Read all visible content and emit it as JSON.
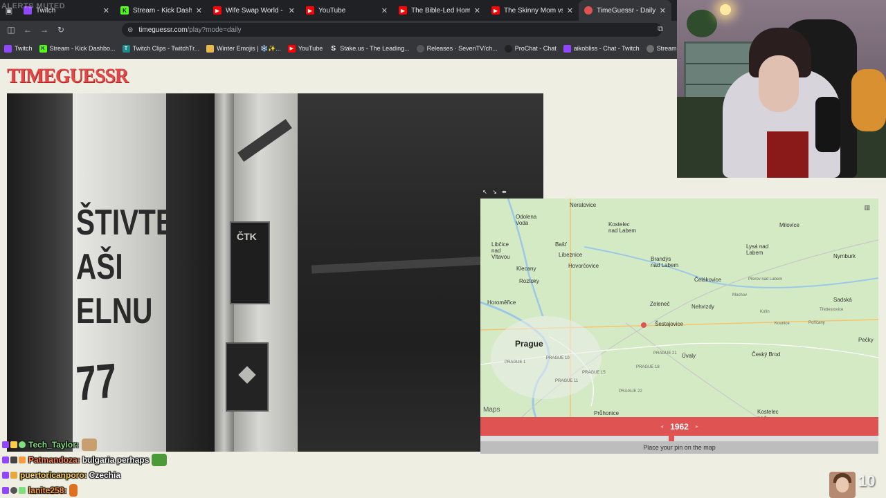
{
  "overlay": {
    "alerts_muted": "ALERTS MUTED"
  },
  "tabs": [
    {
      "label": "Twitch",
      "icon": "twitch-icon",
      "color": "#9146ff"
    },
    {
      "label": "Stream - Kick Dashboar",
      "icon": "kick-icon",
      "color": "#53fc18"
    },
    {
      "label": "Wife Swap World - YouTub",
      "icon": "youtube-icon",
      "color": "#ff0000"
    },
    {
      "label": "YouTube",
      "icon": "youtube-icon",
      "color": "#ff0000"
    },
    {
      "label": "The Bible-Led Home vs. Th",
      "icon": "youtube-icon",
      "color": "#ff0000"
    },
    {
      "label": "The Skinny Mom vs The He",
      "icon": "youtube-icon",
      "color": "#ff0000"
    },
    {
      "label": "TimeGuessr - Daily",
      "icon": "timeguessr-icon",
      "color": "#e05353",
      "active": true
    }
  ],
  "address": {
    "host": "timeguessr.com",
    "path": "/play?mode=daily"
  },
  "bookmarks": [
    {
      "label": "Twitch",
      "color": "#9146ff"
    },
    {
      "label": "Stream - Kick Dashbo...",
      "color": "#53fc18",
      "glyph": "K"
    },
    {
      "label": "Twitch Clips - TwitchTr...",
      "color": "#1f8a8a",
      "glyph": "TT"
    },
    {
      "label": "Winter Emojis | ❄️✨...",
      "color": "#e8b84a",
      "glyph": "▬"
    },
    {
      "label": "YouTube",
      "color": "#ff0000",
      "glyph": "▶"
    },
    {
      "label": "Stake.us - The Leading...",
      "color": "#35363a",
      "glyph": "S"
    },
    {
      "label": "Releases · SevenTV/ch...",
      "color": "#555",
      "glyph": "◉"
    },
    {
      "label": "ProChat - Chat",
      "color": "#222",
      "glyph": "◐"
    },
    {
      "label": "aikobliss - Chat - Twitch",
      "color": "#9146ff",
      "glyph": "▣"
    },
    {
      "label": "StreamElements - Das...",
      "color": "#6e6e6e",
      "glyph": "✪"
    }
  ],
  "game": {
    "logo": "TIMEGUESSR",
    "photo_wall_text": "ŠTIVTE\nAŠI\nELNU",
    "photo_wall_number": "77",
    "photo_sign_text": "ČTK",
    "year": "1962",
    "slider_fraction": 0.48,
    "pin_prompt": "Place your pin on the map",
    "map_attribution": " Maps"
  },
  "map_places": [
    {
      "name": "Neratovice",
      "cls": ""
    },
    {
      "name": "Odolena\nVoda",
      "cls": ""
    },
    {
      "name": "Kostelec\nnad Labem",
      "cls": ""
    },
    {
      "name": "Milovice",
      "cls": ""
    },
    {
      "name": "Libčice\nnad\nVltavou",
      "cls": ""
    },
    {
      "name": "Bašť",
      "cls": ""
    },
    {
      "name": "Lysá nad\nLabem",
      "cls": ""
    },
    {
      "name": "Líbeznice",
      "cls": ""
    },
    {
      "name": "Brandýs\nnad Labem",
      "cls": ""
    },
    {
      "name": "Nymburk",
      "cls": ""
    },
    {
      "name": "Klecany",
      "cls": ""
    },
    {
      "name": "Hovorčovice",
      "cls": ""
    },
    {
      "name": "Čelákovice",
      "cls": ""
    },
    {
      "name": "Roztoky",
      "cls": ""
    },
    {
      "name": "Horoměřice",
      "cls": ""
    },
    {
      "name": "Zeleneč",
      "cls": ""
    },
    {
      "name": "Nehvizdy",
      "cls": ""
    },
    {
      "name": "Prague",
      "cls": "big"
    },
    {
      "name": "Šestajovice",
      "cls": ""
    },
    {
      "name": "Úvaly",
      "cls": ""
    },
    {
      "name": "Český Brod",
      "cls": ""
    },
    {
      "name": "Pečky",
      "cls": ""
    },
    {
      "name": "Průhonice",
      "cls": ""
    },
    {
      "name": "Kostelec\nnad",
      "cls": ""
    },
    {
      "name": "Sadská",
      "cls": ""
    },
    {
      "name": "PRAGUE 1",
      "cls": "small"
    },
    {
      "name": "PRAGUE 10",
      "cls": "small"
    },
    {
      "name": "PRAGUE 15",
      "cls": "small"
    },
    {
      "name": "PRAGUE 21",
      "cls": "small"
    },
    {
      "name": "PRAGUE 22",
      "cls": "small"
    },
    {
      "name": "PRAGUE 18",
      "cls": "small"
    },
    {
      "name": "PRAGUE 11",
      "cls": "small"
    },
    {
      "name": "Kolín",
      "cls": "small"
    },
    {
      "name": "Mochov",
      "cls": "small"
    },
    {
      "name": "Přerov nad Labem",
      "cls": "small"
    },
    {
      "name": "Třebestovice",
      "cls": "small"
    },
    {
      "name": "Kounice",
      "cls": "small"
    },
    {
      "name": "Poříčany",
      "cls": "small"
    }
  ],
  "chat": [
    {
      "user": "Tech_Taylor:",
      "color": "#7fe07f",
      "msg": "",
      "emote_color": "#c8a070"
    },
    {
      "user": "Patmandoza:",
      "color": "#ff7f50",
      "msg": "bulgaria perhaps",
      "emote_color": "#4a9a3a"
    },
    {
      "user": "puertoricanporo:",
      "color": "#ffd24a",
      "msg": "Czechia",
      "emote_color": ""
    },
    {
      "user": "lanite258:",
      "color": "#ff9a3c",
      "msg": "",
      "emote_color": "#e07020"
    }
  ],
  "viewer_count": "10",
  "colors": {
    "accent": "#e05353",
    "chrome_bg": "#202124",
    "page_bg": "#eeeee3"
  }
}
